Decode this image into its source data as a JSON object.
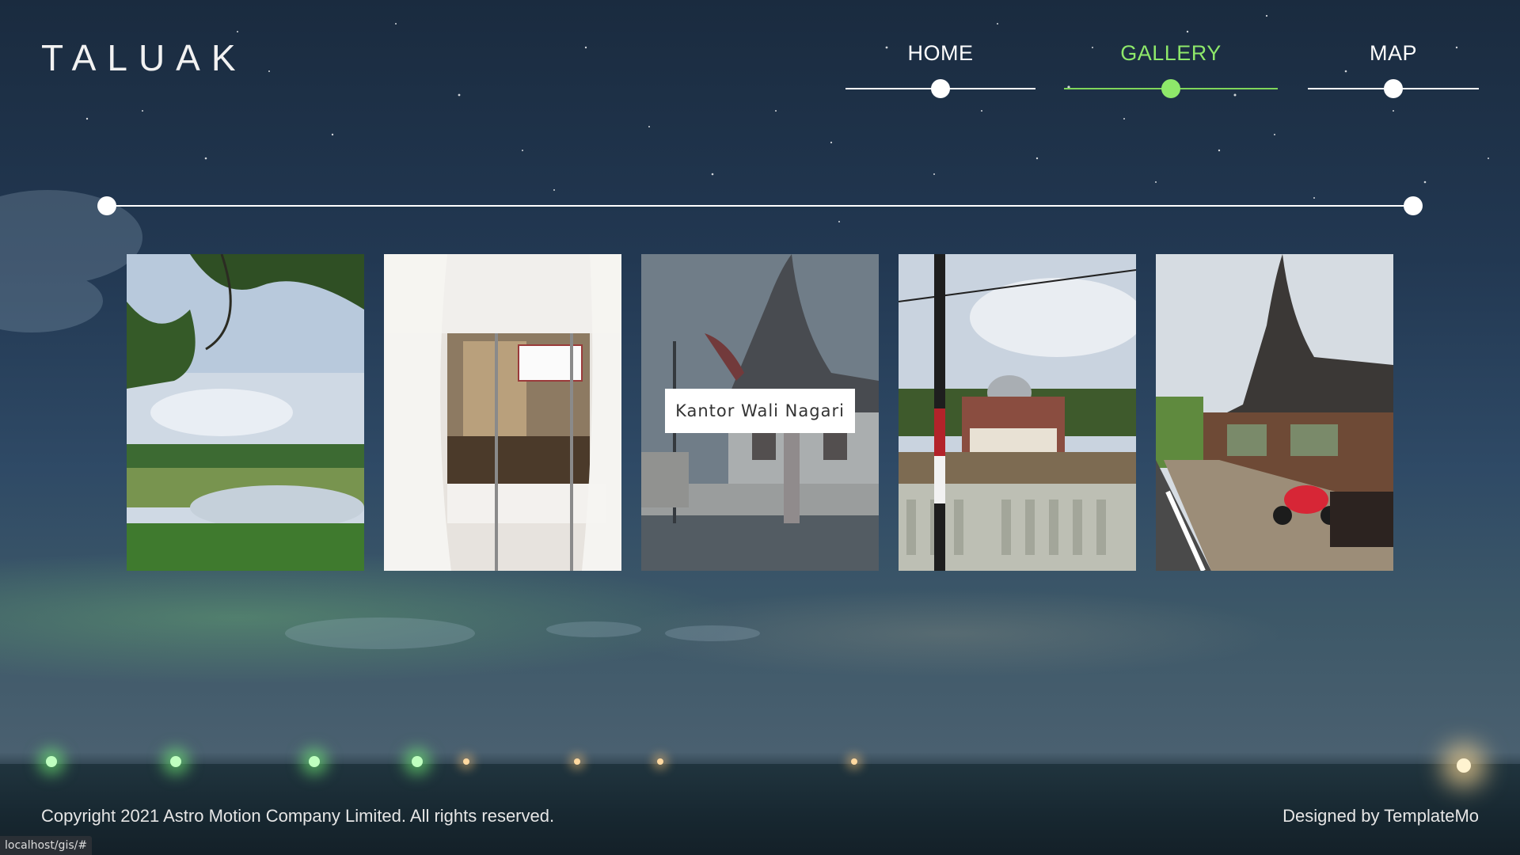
{
  "brand": {
    "logo": "TALUAK"
  },
  "nav": {
    "items": [
      {
        "label": "HOME",
        "active": false
      },
      {
        "label": "GALLERY",
        "active": true
      },
      {
        "label": "MAP",
        "active": false
      }
    ],
    "active_color": "#8ee86a"
  },
  "gallery": {
    "images": [
      {
        "icon": "lake-landscape-image",
        "caption": ""
      },
      {
        "icon": "curtained-grave-image",
        "caption": ""
      },
      {
        "icon": "traditional-office-image",
        "caption": "Kantor Wali Nagari"
      },
      {
        "icon": "mosque-image",
        "caption": ""
      },
      {
        "icon": "roadside-house-image",
        "caption": ""
      }
    ]
  },
  "footer": {
    "copyright": "Copyright 2021 Astro Motion Company Limited. All rights reserved.",
    "designer": "Designed by TemplateMo"
  },
  "status_bar": {
    "url": "localhost/gis/#"
  }
}
